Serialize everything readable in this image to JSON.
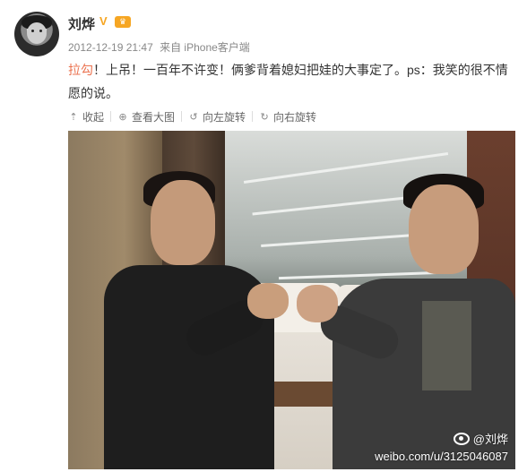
{
  "user": {
    "name": "刘烨",
    "verified_icon": "verified-v-icon",
    "vip_icon": "vip-badge-icon"
  },
  "meta": {
    "timestamp": "2012-12-19 21:47",
    "source": "来自 iPhone客户端"
  },
  "post": {
    "tag": "拉勾",
    "text": "！上吊！一百年不许变！俩爹背着媳妇把娃的大事定了。ps：我笑的很不情愿的说。"
  },
  "actions": [
    {
      "icon": "collapse-icon",
      "label": "收起"
    },
    {
      "icon": "zoom-icon",
      "label": "查看大图"
    },
    {
      "icon": "rotate-left-icon",
      "label": "向左旋转"
    },
    {
      "icon": "rotate-right-icon",
      "label": "向右旋转"
    }
  ],
  "photo": {
    "watermark_user": "@刘烨",
    "watermark_url": "weibo.com/u/3125046087"
  },
  "colors": {
    "accent_tag": "#eb7350",
    "verified": "#f6a623",
    "meta_text": "#888888"
  }
}
